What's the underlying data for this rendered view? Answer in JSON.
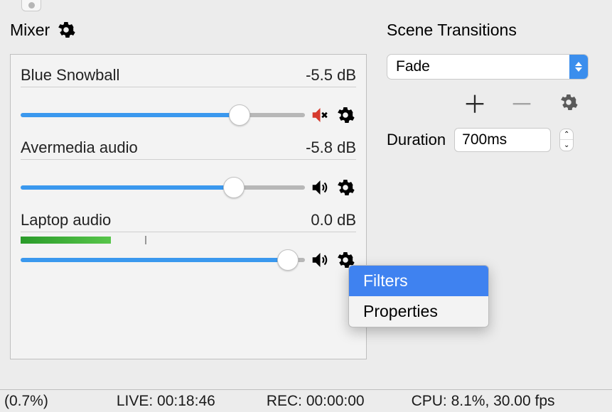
{
  "mixer": {
    "title": "Mixer",
    "channels": [
      {
        "name": "Blue Snowball",
        "db": "-5.5 dB",
        "slider_pct": 77,
        "muted": true,
        "meter_pct": 0
      },
      {
        "name": "Avermedia audio",
        "db": "-5.8 dB",
        "slider_pct": 75,
        "muted": false,
        "meter_pct": 0
      },
      {
        "name": "Laptop audio",
        "db": "0.0 dB",
        "slider_pct": 94,
        "muted": false,
        "meter_pct": 27,
        "meter_tick_pct": 37
      }
    ]
  },
  "transitions": {
    "title": "Scene Transitions",
    "selected": "Fade",
    "duration_label": "Duration",
    "duration_value": "700ms"
  },
  "context_menu": {
    "items": [
      {
        "label": "Filters",
        "selected": true
      },
      {
        "label": "Properties",
        "selected": false
      }
    ]
  },
  "status": {
    "drop": "(0.7%)",
    "live": "LIVE: 00:18:46",
    "rec": "REC: 00:00:00",
    "cpu": "CPU: 8.1%, 30.00 fps"
  },
  "icons": {
    "gear": "gear-icon",
    "plus": "plus-icon",
    "minus": "minus-icon",
    "speaker": "speaker-icon",
    "speaker_muted": "speaker-muted-icon"
  }
}
